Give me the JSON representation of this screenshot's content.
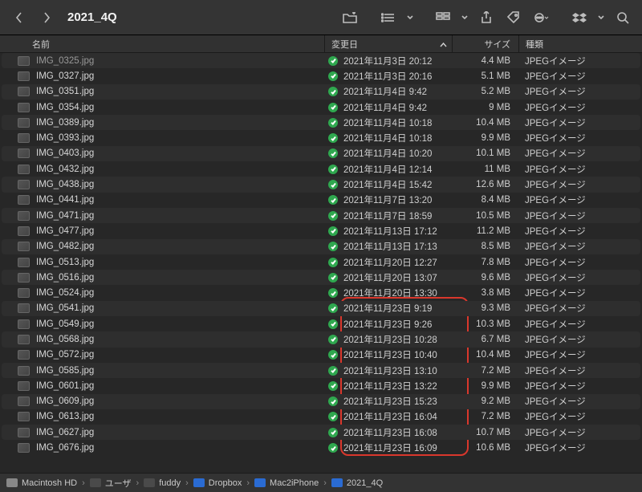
{
  "window": {
    "title": "2021_4Q"
  },
  "columns": {
    "name": "名前",
    "date": "変更日",
    "size": "サイズ",
    "kind": "種類"
  },
  "path": [
    "Macintosh HD",
    "ユーザ",
    "fuddy",
    "Dropbox",
    "Mac2iPhone",
    "2021_4Q"
  ],
  "files": [
    {
      "name": "IMG_0325.jpg",
      "date": "2021年11月3日 20:12",
      "size": "4.4 MB",
      "kind": "JPEGイメージ",
      "cut": true
    },
    {
      "name": "IMG_0327.jpg",
      "date": "2021年11月3日 20:16",
      "size": "5.1 MB",
      "kind": "JPEGイメージ"
    },
    {
      "name": "IMG_0351.jpg",
      "date": "2021年11月4日 9:42",
      "size": "5.2 MB",
      "kind": "JPEGイメージ"
    },
    {
      "name": "IMG_0354.jpg",
      "date": "2021年11月4日 9:42",
      "size": "9 MB",
      "kind": "JPEGイメージ"
    },
    {
      "name": "IMG_0389.jpg",
      "date": "2021年11月4日 10:18",
      "size": "10.4 MB",
      "kind": "JPEGイメージ"
    },
    {
      "name": "IMG_0393.jpg",
      "date": "2021年11月4日 10:18",
      "size": "9.9 MB",
      "kind": "JPEGイメージ"
    },
    {
      "name": "IMG_0403.jpg",
      "date": "2021年11月4日 10:20",
      "size": "10.1 MB",
      "kind": "JPEGイメージ"
    },
    {
      "name": "IMG_0432.jpg",
      "date": "2021年11月4日 12:14",
      "size": "11 MB",
      "kind": "JPEGイメージ"
    },
    {
      "name": "IMG_0438.jpg",
      "date": "2021年11月4日 15:42",
      "size": "12.6 MB",
      "kind": "JPEGイメージ"
    },
    {
      "name": "IMG_0441.jpg",
      "date": "2021年11月7日 13:20",
      "size": "8.4 MB",
      "kind": "JPEGイメージ"
    },
    {
      "name": "IMG_0471.jpg",
      "date": "2021年11月7日 18:59",
      "size": "10.5 MB",
      "kind": "JPEGイメージ"
    },
    {
      "name": "IMG_0477.jpg",
      "date": "2021年11月13日 17:12",
      "size": "11.2 MB",
      "kind": "JPEGイメージ"
    },
    {
      "name": "IMG_0482.jpg",
      "date": "2021年11月13日 17:13",
      "size": "8.5 MB",
      "kind": "JPEGイメージ"
    },
    {
      "name": "IMG_0513.jpg",
      "date": "2021年11月20日 12:27",
      "size": "7.8 MB",
      "kind": "JPEGイメージ"
    },
    {
      "name": "IMG_0516.jpg",
      "date": "2021年11月20日 13:07",
      "size": "9.6 MB",
      "kind": "JPEGイメージ"
    },
    {
      "name": "IMG_0524.jpg",
      "date": "2021年11月20日 13:30",
      "size": "3.8 MB",
      "kind": "JPEGイメージ"
    },
    {
      "name": "IMG_0541.jpg",
      "date": "2021年11月23日 9:19",
      "size": "9.3 MB",
      "kind": "JPEGイメージ"
    },
    {
      "name": "IMG_0549.jpg",
      "date": "2021年11月23日 9:26",
      "size": "10.3 MB",
      "kind": "JPEGイメージ"
    },
    {
      "name": "IMG_0568.jpg",
      "date": "2021年11月23日 10:28",
      "size": "6.7 MB",
      "kind": "JPEGイメージ"
    },
    {
      "name": "IMG_0572.jpg",
      "date": "2021年11月23日 10:40",
      "size": "10.4 MB",
      "kind": "JPEGイメージ"
    },
    {
      "name": "IMG_0585.jpg",
      "date": "2021年11月23日 13:10",
      "size": "7.2 MB",
      "kind": "JPEGイメージ"
    },
    {
      "name": "IMG_0601.jpg",
      "date": "2021年11月23日 13:22",
      "size": "9.9 MB",
      "kind": "JPEGイメージ"
    },
    {
      "name": "IMG_0609.jpg",
      "date": "2021年11月23日 15:23",
      "size": "9.2 MB",
      "kind": "JPEGイメージ"
    },
    {
      "name": "IMG_0613.jpg",
      "date": "2021年11月23日 16:04",
      "size": "7.2 MB",
      "kind": "JPEGイメージ"
    },
    {
      "name": "IMG_0627.jpg",
      "date": "2021年11月23日 16:08",
      "size": "10.7 MB",
      "kind": "JPEGイメージ"
    },
    {
      "name": "IMG_0676.jpg",
      "date": "2021年11月23日 16:09",
      "size": "10.6 MB",
      "kind": "JPEGイメージ"
    }
  ]
}
